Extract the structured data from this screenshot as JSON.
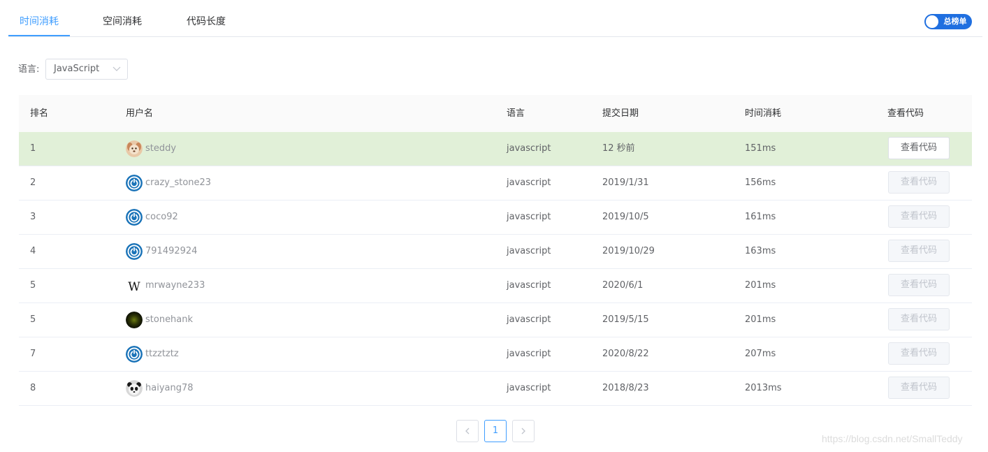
{
  "tabs": [
    {
      "label": "时间消耗",
      "active": true
    },
    {
      "label": "空间消耗",
      "active": false
    },
    {
      "label": "代码长度",
      "active": false
    }
  ],
  "switch": {
    "label": "总榜单",
    "on": true,
    "color": "#1f6fe0"
  },
  "filter": {
    "label": "语言:",
    "value": "JavaScript"
  },
  "table": {
    "headers": [
      "排名",
      "用户名",
      "语言",
      "提交日期",
      "时间消耗",
      "查看代码"
    ],
    "rows": [
      {
        "rank": "1",
        "user": "steddy",
        "avatar": "dog-avatar-icon",
        "lang": "javascript",
        "date": "12 秒前",
        "time": "151ms",
        "btn": "查看代码",
        "enabled": true
      },
      {
        "rank": "2",
        "user": "crazy_stone23",
        "avatar": "power-avatar-icon",
        "lang": "javascript",
        "date": "2019/1/31",
        "time": "156ms",
        "btn": "查看代码",
        "enabled": false
      },
      {
        "rank": "3",
        "user": "coco92",
        "avatar": "power-avatar-icon",
        "lang": "javascript",
        "date": "2019/10/5",
        "time": "161ms",
        "btn": "查看代码",
        "enabled": false
      },
      {
        "rank": "4",
        "user": "791492924",
        "avatar": "power-avatar-icon",
        "lang": "javascript",
        "date": "2019/10/29",
        "time": "163ms",
        "btn": "查看代码",
        "enabled": false
      },
      {
        "rank": "5",
        "user": "mrwayne233",
        "avatar": "w-letter-avatar-icon",
        "lang": "javascript",
        "date": "2020/6/1",
        "time": "201ms",
        "btn": "查看代码",
        "enabled": false
      },
      {
        "rank": "5",
        "user": "stonehank",
        "avatar": "dark-orb-avatar-icon",
        "lang": "javascript",
        "date": "2019/5/15",
        "time": "201ms",
        "btn": "查看代码",
        "enabled": false
      },
      {
        "rank": "7",
        "user": "ttzztztz",
        "avatar": "power-avatar-icon",
        "lang": "javascript",
        "date": "2020/8/22",
        "time": "207ms",
        "btn": "查看代码",
        "enabled": false
      },
      {
        "rank": "8",
        "user": "haiyang78",
        "avatar": "panda-avatar-icon",
        "lang": "javascript",
        "date": "2018/8/23",
        "time": "2013ms",
        "btn": "查看代码",
        "enabled": false
      }
    ]
  },
  "pagination": {
    "current": "1"
  },
  "watermark": "https://blog.csdn.net/SmallTeddy",
  "colors": {
    "accent": "#409eff",
    "highlight_row": "#e1f0d8"
  }
}
